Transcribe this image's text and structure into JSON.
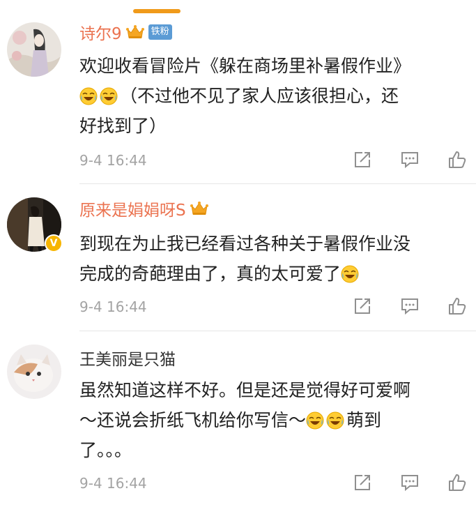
{
  "comments": [
    {
      "user": "诗尔9",
      "badge": "铁粉",
      "text_lines": [
        "欢迎收看冒险片《躲在商场里补暑假作业》",
        "（不过他不见了家人应该很担心，还",
        "好找到了）"
      ],
      "time": "9-4 16:44"
    },
    {
      "user": "原来是娟娟呀S",
      "verified": "V",
      "text_lines": [
        "到现在为止我已经看过各种关于暑假作业没",
        "完成的奇葩理由了，真的太可爱了"
      ],
      "time": "9-4 16:44"
    },
    {
      "user": "王美丽是只猫",
      "text_lines": [
        "虽然知道这样不好。但是还是觉得好可爱啊",
        "～还说会折纸飞机给你写信～",
        "萌到",
        "了。。。"
      ],
      "time": "9-4 16:44"
    }
  ],
  "icons": {
    "crown": "crown-icon",
    "emoji": "laugh-cry-emoji-icon",
    "repost": "repost-icon",
    "comment": "comment-icon",
    "like": "like-icon"
  },
  "colors": {
    "accent_name": "#eb7350",
    "badge_blue": "#5b9bd5",
    "verified": "#f7b500",
    "indicator": "#f09a1a",
    "time_gray": "#a3a3a3"
  }
}
